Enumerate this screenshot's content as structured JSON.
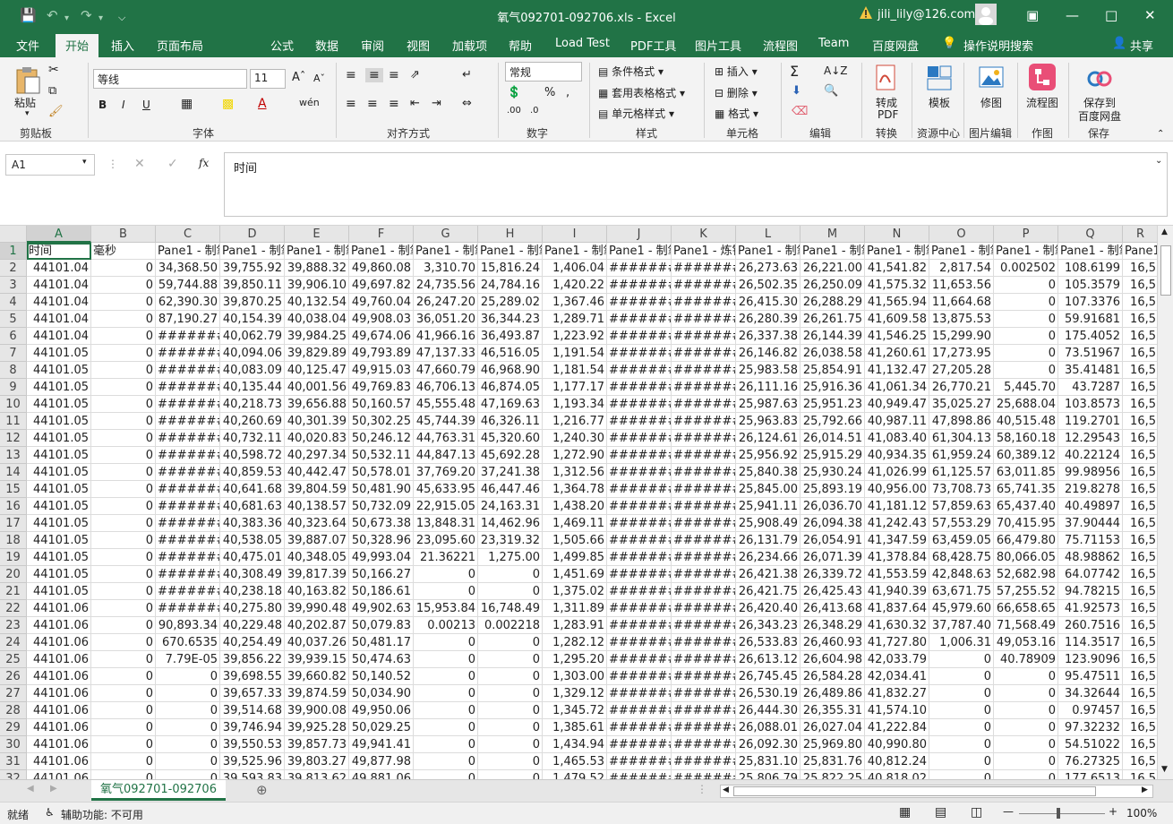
{
  "titlebar": {
    "title": "氧气092701-092706.xls  -  Excel",
    "user": "jili_lily@126.com",
    "warn_icon": "warning-icon",
    "accent": "#217346"
  },
  "menu": {
    "items": [
      "文件",
      "开始",
      "插入",
      "页面布局",
      "公式",
      "数据",
      "审阅",
      "视图",
      "加载项",
      "帮助",
      "Load Test",
      "PDF工具",
      "图片工具",
      "流程图",
      "Team",
      "百度网盘"
    ],
    "tell_me": "操作说明搜索",
    "share": "共享"
  },
  "ribbon": {
    "paste": "粘贴",
    "font_name": "等线",
    "font_size": "11",
    "number_format": "常规",
    "cond_format": "条件格式",
    "table_format": "套用表格格式",
    "cell_style": "单元格样式",
    "insert": "插入",
    "delete": "删除",
    "format": "格式",
    "to_pdf_1": "转成",
    "to_pdf_2": "PDF",
    "template": "模板",
    "repair": "修图",
    "flowchart": "流程图",
    "save_to_1": "保存到",
    "save_to_2": "百度网盘",
    "groups": {
      "clipboard": "剪贴板",
      "font": "字体",
      "align": "对齐方式",
      "number": "数字",
      "style": "样式",
      "cells": "单元格",
      "edit": "编辑",
      "convert": "转换",
      "resource": "资源中心",
      "image_edit": "图片编辑",
      "draw": "作图",
      "save": "保存"
    }
  },
  "formula_bar": {
    "name_box": "A1",
    "content": "时间"
  },
  "grid": {
    "columns": [
      "A",
      "B",
      "C",
      "D",
      "E",
      "F",
      "G",
      "H",
      "I",
      "J",
      "K",
      "L",
      "M",
      "N",
      "O",
      "P",
      "Q",
      "R"
    ],
    "header_row": [
      "时间",
      "毫秒",
      "Pane1 - 制氧",
      "Pane1 - 制氧",
      "Pane1 - 制氧",
      "Pane1 - 制氧",
      "Pane1 - 制氧",
      "Pane1 - 制氧",
      "Pane1 - 制氧",
      "Pane1 - 制氧",
      "Pane1 - 炼钢",
      "Pane1 - 制氧",
      "Pane1 - 制氧",
      "Pane1 - 制氧",
      "Pane1 - 制氧",
      "Pane1 - 制氧",
      "Pane1 - 制氧",
      "Pane1"
    ],
    "rows": [
      [
        "44101.04",
        "0",
        "34,368.50",
        "39,755.92",
        "39,888.32",
        "49,860.08",
        "3,310.70",
        "15,816.24",
        "1,406.04",
        "#######",
        "#######",
        "26,273.63",
        "26,221.00",
        "41,541.82",
        "2,817.54",
        "0.002502",
        "108.6199",
        "16,5"
      ],
      [
        "44101.04",
        "0",
        "59,744.88",
        "39,850.11",
        "39,906.10",
        "49,697.82",
        "24,735.56",
        "24,784.16",
        "1,420.22",
        "#######",
        "#######",
        "26,502.35",
        "26,250.09",
        "41,575.32",
        "11,653.56",
        "0",
        "105.3579",
        "16,5"
      ],
      [
        "44101.04",
        "0",
        "62,390.30",
        "39,870.25",
        "40,132.54",
        "49,760.04",
        "26,247.20",
        "25,289.02",
        "1,367.46",
        "#######",
        "#######",
        "26,415.30",
        "26,288.29",
        "41,565.94",
        "11,664.68",
        "0",
        "107.3376",
        "16,5"
      ],
      [
        "44101.04",
        "0",
        "87,190.27",
        "40,154.39",
        "40,038.04",
        "49,908.03",
        "36,051.20",
        "36,344.23",
        "1,289.71",
        "#######",
        "#######",
        "26,280.39",
        "26,261.75",
        "41,609.58",
        "13,875.53",
        "0",
        "59.91681",
        "16,5"
      ],
      [
        "44101.04",
        "0",
        "#######",
        "40,062.79",
        "39,984.25",
        "49,674.06",
        "41,966.16",
        "36,493.87",
        "1,223.92",
        "#######",
        "#######",
        "26,337.38",
        "26,144.39",
        "41,546.25",
        "15,299.90",
        "0",
        "175.4052",
        "16,5"
      ],
      [
        "44101.05",
        "0",
        "#######",
        "40,094.06",
        "39,829.89",
        "49,793.89",
        "47,137.33",
        "46,516.05",
        "1,191.54",
        "#######",
        "#######",
        "26,146.82",
        "26,038.58",
        "41,260.61",
        "17,273.95",
        "0",
        "73.51967",
        "16,5"
      ],
      [
        "44101.05",
        "0",
        "#######",
        "40,083.09",
        "40,125.47",
        "49,915.03",
        "47,660.79",
        "46,968.90",
        "1,181.54",
        "#######",
        "#######",
        "25,983.58",
        "25,854.91",
        "41,132.47",
        "27,205.28",
        "0",
        "35.41481",
        "16,5"
      ],
      [
        "44101.05",
        "0",
        "#######",
        "40,135.44",
        "40,001.56",
        "49,769.83",
        "46,706.13",
        "46,874.05",
        "1,177.17",
        "#######",
        "#######",
        "26,111.16",
        "25,916.36",
        "41,061.34",
        "26,770.21",
        "5,445.70",
        "43.7287",
        "16,5"
      ],
      [
        "44101.05",
        "0",
        "#######",
        "40,218.73",
        "39,656.88",
        "50,160.57",
        "45,555.48",
        "47,169.63",
        "1,193.34",
        "#######",
        "#######",
        "25,987.63",
        "25,951.23",
        "40,949.47",
        "35,025.27",
        "25,688.04",
        "103.8573",
        "16,5"
      ],
      [
        "44101.05",
        "0",
        "#######",
        "40,260.69",
        "40,301.39",
        "50,302.25",
        "45,744.39",
        "46,326.11",
        "1,216.77",
        "#######",
        "#######",
        "25,963.83",
        "25,792.66",
        "40,987.11",
        "47,898.86",
        "40,515.48",
        "119.2701",
        "16,5"
      ],
      [
        "44101.05",
        "0",
        "#######",
        "40,732.11",
        "40,020.83",
        "50,246.12",
        "44,763.31",
        "45,320.60",
        "1,240.30",
        "#######",
        "#######",
        "26,124.61",
        "26,014.51",
        "41,083.40",
        "61,304.13",
        "58,160.18",
        "12.29543",
        "16,5"
      ],
      [
        "44101.05",
        "0",
        "#######",
        "40,598.72",
        "40,297.34",
        "50,532.11",
        "44,847.13",
        "45,692.28",
        "1,272.90",
        "#######",
        "#######",
        "25,956.92",
        "25,915.29",
        "40,934.35",
        "61,959.24",
        "60,389.12",
        "40.22124",
        "16,5"
      ],
      [
        "44101.05",
        "0",
        "#######",
        "40,859.53",
        "40,442.47",
        "50,578.01",
        "37,769.20",
        "37,241.38",
        "1,312.56",
        "#######",
        "#######",
        "25,840.38",
        "25,930.24",
        "41,026.99",
        "61,125.57",
        "63,011.85",
        "99.98956",
        "16,5"
      ],
      [
        "44101.05",
        "0",
        "#######",
        "40,641.68",
        "39,804.59",
        "50,481.90",
        "45,633.95",
        "46,447.46",
        "1,364.78",
        "#######",
        "#######",
        "25,845.00",
        "25,893.19",
        "40,956.00",
        "73,708.73",
        "65,741.35",
        "219.8278",
        "16,5"
      ],
      [
        "44101.05",
        "0",
        "#######",
        "40,681.63",
        "40,138.57",
        "50,732.09",
        "22,915.05",
        "24,163.31",
        "1,438.20",
        "#######",
        "#######",
        "25,941.11",
        "26,036.70",
        "41,181.12",
        "57,859.63",
        "65,437.40",
        "40.49897",
        "16,5"
      ],
      [
        "44101.05",
        "0",
        "#######",
        "40,383.36",
        "40,323.64",
        "50,673.38",
        "13,848.31",
        "14,462.96",
        "1,469.11",
        "#######",
        "#######",
        "25,908.49",
        "26,094.38",
        "41,242.43",
        "57,553.29",
        "70,415.95",
        "37.90444",
        "16,5"
      ],
      [
        "44101.05",
        "0",
        "#######",
        "40,538.05",
        "39,887.07",
        "50,328.96",
        "23,095.60",
        "23,319.32",
        "1,505.66",
        "#######",
        "#######",
        "26,131.79",
        "26,054.91",
        "41,347.59",
        "63,459.05",
        "66,479.80",
        "75.71153",
        "16,5"
      ],
      [
        "44101.05",
        "0",
        "#######",
        "40,475.01",
        "40,348.05",
        "49,993.04",
        "21.36221",
        "1,275.00",
        "1,499.85",
        "#######",
        "#######",
        "26,234.66",
        "26,071.39",
        "41,378.84",
        "68,428.75",
        "80,066.05",
        "48.98862",
        "16,5"
      ],
      [
        "44101.05",
        "0",
        "#######",
        "40,308.49",
        "39,817.39",
        "50,166.27",
        "0",
        "0",
        "1,451.69",
        "#######",
        "#######",
        "26,421.38",
        "26,339.72",
        "41,553.59",
        "42,848.63",
        "52,682.98",
        "64.07742",
        "16,5"
      ],
      [
        "44101.05",
        "0",
        "#######",
        "40,238.18",
        "40,163.82",
        "50,186.61",
        "0",
        "0",
        "1,375.02",
        "#######",
        "#######",
        "26,421.75",
        "26,425.43",
        "41,940.39",
        "63,671.75",
        "57,255.52",
        "94.78215",
        "16,5"
      ],
      [
        "44101.06",
        "0",
        "#######",
        "40,275.80",
        "39,990.48",
        "49,902.63",
        "15,953.84",
        "16,748.49",
        "1,311.89",
        "#######",
        "#######",
        "26,420.40",
        "26,413.68",
        "41,837.64",
        "45,979.60",
        "66,658.65",
        "41.92573",
        "16,5"
      ],
      [
        "44101.06",
        "0",
        "90,893.34",
        "40,229.48",
        "40,202.87",
        "50,079.83",
        "0.00213",
        "0.002218",
        "1,283.91",
        "#######",
        "#######",
        "26,343.23",
        "26,348.29",
        "41,630.32",
        "37,787.40",
        "71,568.49",
        "260.7516",
        "16,5"
      ],
      [
        "44101.06",
        "0",
        "670.6535",
        "40,254.49",
        "40,037.26",
        "50,481.17",
        "0",
        "0",
        "1,282.12",
        "#######",
        "#######",
        "26,533.83",
        "26,460.93",
        "41,727.80",
        "1,006.31",
        "49,053.16",
        "114.3517",
        "16,5"
      ],
      [
        "44101.06",
        "0",
        "7.79E-05",
        "39,856.22",
        "39,939.15",
        "50,474.63",
        "0",
        "0",
        "1,295.20",
        "#######",
        "#######",
        "26,613.12",
        "26,604.98",
        "42,033.79",
        "0",
        "40.78909",
        "123.9096",
        "16,5"
      ],
      [
        "44101.06",
        "0",
        "0",
        "39,698.55",
        "39,660.82",
        "50,140.52",
        "0",
        "0",
        "1,303.00",
        "#######",
        "#######",
        "26,745.45",
        "26,584.28",
        "42,034.41",
        "0",
        "0",
        "95.47511",
        "16,5"
      ],
      [
        "44101.06",
        "0",
        "0",
        "39,657.33",
        "39,874.59",
        "50,034.90",
        "0",
        "0",
        "1,329.12",
        "#######",
        "#######",
        "26,530.19",
        "26,489.86",
        "41,832.27",
        "0",
        "0",
        "34.32644",
        "16,5"
      ],
      [
        "44101.06",
        "0",
        "0",
        "39,514.68",
        "39,900.08",
        "49,950.06",
        "0",
        "0",
        "1,345.72",
        "#######",
        "#######",
        "26,444.30",
        "26,355.31",
        "41,574.10",
        "0",
        "0",
        "0.97457",
        "16,5"
      ],
      [
        "44101.06",
        "0",
        "0",
        "39,746.94",
        "39,925.28",
        "50,029.25",
        "0",
        "0",
        "1,385.61",
        "#######",
        "#######",
        "26,088.01",
        "26,027.04",
        "41,222.84",
        "0",
        "0",
        "97.32232",
        "16,5"
      ],
      [
        "44101.06",
        "0",
        "0",
        "39,550.53",
        "39,857.73",
        "49,941.41",
        "0",
        "0",
        "1,434.94",
        "#######",
        "#######",
        "26,092.30",
        "25,969.80",
        "40,990.80",
        "0",
        "0",
        "54.51022",
        "16,5"
      ],
      [
        "44101.06",
        "0",
        "0",
        "39,525.96",
        "39,803.27",
        "49,877.98",
        "0",
        "0",
        "1,465.53",
        "#######",
        "#######",
        "25,831.10",
        "25,831.76",
        "40,812.24",
        "0",
        "0",
        "76.27325",
        "16,5"
      ]
    ],
    "partial_row": [
      "44101.06",
      "0",
      "0",
      "39,593.83",
      "39,813.62",
      "49,881.06",
      "0",
      "0",
      "1,479.52",
      "#######",
      "#######",
      "25,806.79",
      "25,822.25",
      "40,818.02",
      "0",
      "0",
      "177.6513",
      "16,5"
    ]
  },
  "sheet": {
    "tab_name": "氧气092701-092706"
  },
  "status": {
    "ready": "就绪",
    "accessibility": "辅助功能: 不可用",
    "zoom": "100%"
  }
}
